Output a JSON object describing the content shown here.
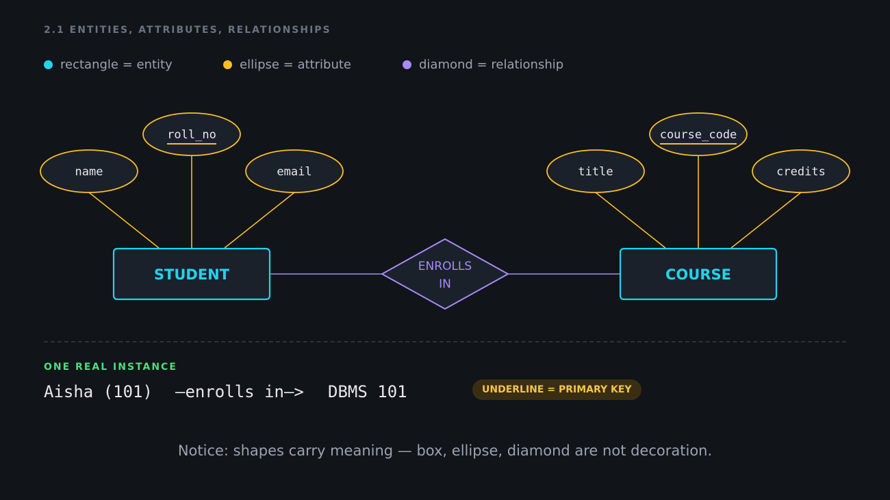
{
  "header": {
    "section_title": "2.1  ENTITIES, ATTRIBUTES, RELATIONSHIPS"
  },
  "legend": [
    {
      "label": "rectangle = entity",
      "color": "#22d3ee"
    },
    {
      "label": "ellipse = attribute",
      "color": "#fbbf24"
    },
    {
      "label": "diamond = relationship",
      "color": "#a78bfa"
    }
  ],
  "diagram": {
    "entities": [
      {
        "label": "STUDENT"
      },
      {
        "label": "COURSE"
      }
    ],
    "relationship": {
      "line1": "ENROLLS",
      "line2": "IN"
    },
    "attributes": {
      "student": [
        {
          "label": "name",
          "primary_key": false
        },
        {
          "label": "roll_no",
          "primary_key": true
        },
        {
          "label": "email",
          "primary_key": false
        }
      ],
      "course": [
        {
          "label": "title",
          "primary_key": false
        },
        {
          "label": "course_code",
          "primary_key": true
        },
        {
          "label": "credits",
          "primary_key": false
        }
      ]
    }
  },
  "instance": {
    "label": "ONE REAL INSTANCE",
    "left": "Aisha (101)",
    "arrow": "—enrolls in—>",
    "right": "DBMS 101",
    "badge": "UNDERLINE = PRIMARY KEY"
  },
  "notice": "Notice: shapes carry meaning — box, ellipse, diamond are not decoration.",
  "colors": {
    "entity": "#22d3ee",
    "attribute": "#fbbf24",
    "relationship": "#a78bfa",
    "fill": "#1b212a",
    "text": "#e5e7eb"
  }
}
